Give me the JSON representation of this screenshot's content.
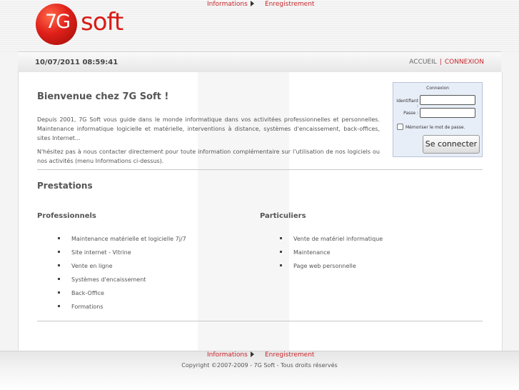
{
  "header": {
    "logo_left": "7G",
    "logo_right": "soft",
    "menu": {
      "informations": "Informations",
      "enregistrement": "Enregistrement"
    }
  },
  "bar": {
    "datetime": "10/07/2011 08:59:41",
    "accueil": "ACCUEIL",
    "separator": "|",
    "connexion": "CONNEXION"
  },
  "welcome": {
    "title": "Bienvenue chez 7G Soft !",
    "paragraph1": "Depuis 2001, 7G Soft vous guide dans le monde informatique dans vos activitées professionnelles et personnelles. Maintenance informatique logicielle et matérielle, interventions à distance, systèmes d'encaissement, back-offices, sites Internet...",
    "paragraph2": "N'hésitez pas à nous contacter directement pour toute information complémentaire sur l'utilisation de nos logiciels ou nos activités (menu Informations ci-dessus)."
  },
  "login": {
    "title": "Connexion",
    "identifiant_label": "Identifiant :",
    "passe_label": "Passe :",
    "identifiant_value": "",
    "passe_value": "",
    "remember_label": "Mémoriser le mot de passe.",
    "submit_label": "Se connecter"
  },
  "prestations": {
    "title": "Prestations",
    "professionnels": {
      "title": "Professionnels",
      "items": [
        "Maintenance matérielle et logicielle 7j/7",
        "Site internet - Vitrine",
        "Vente en ligne",
        "Systèmes d'encaissement",
        "Back-Office",
        "Formations"
      ]
    },
    "particuliers": {
      "title": "Particuliers",
      "items": [
        "Vente de matériel informatique",
        "Maintenance",
        "Page web personnelle"
      ]
    }
  },
  "footer": {
    "menu": {
      "informations": "Informations",
      "enregistrement": "Enregistrement"
    },
    "copyright": "Copyright ©2007-2009 - 7G Soft - Tous droits réservés"
  },
  "colors": {
    "accent": "#c8262b",
    "logo_red": "#d81c16",
    "login_bg": "#e8eef8"
  }
}
